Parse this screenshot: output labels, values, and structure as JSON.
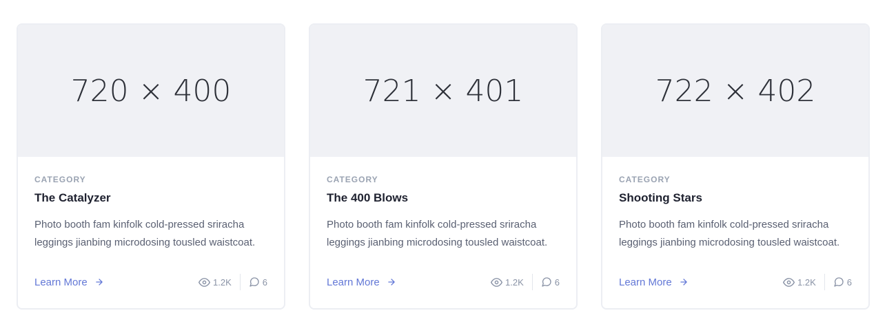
{
  "cards": [
    {
      "thumb_w": "720",
      "thumb_h": "400",
      "thumb_x": "×",
      "category": "CATEGORY",
      "title": "The Catalyzer",
      "description": "Photo booth fam kinfolk cold-pressed sriracha leggings jianbing microdosing tousled waistcoat.",
      "link_label": "Learn More",
      "views": "1.2K",
      "comments": "6"
    },
    {
      "thumb_w": "721",
      "thumb_h": "401",
      "thumb_x": "×",
      "category": "CATEGORY",
      "title": "The 400 Blows",
      "description": "Photo booth fam kinfolk cold-pressed sriracha leggings jianbing microdosing tousled waistcoat.",
      "link_label": "Learn More",
      "views": "1.2K",
      "comments": "6"
    },
    {
      "thumb_w": "722",
      "thumb_h": "402",
      "thumb_x": "×",
      "category": "CATEGORY",
      "title": "Shooting Stars",
      "description": "Photo booth fam kinfolk cold-pressed sriracha leggings jianbing microdosing tousled waistcoat.",
      "link_label": "Learn More",
      "views": "1.2K",
      "comments": "6"
    }
  ],
  "icons": {
    "arrow": "arrow-right-icon",
    "views": "eye-icon",
    "comments": "chat-bubble-icon"
  },
  "colors": {
    "accent": "#6277d6",
    "thumb_bg": "#f0f1f5",
    "muted": "#9aa3b2"
  }
}
